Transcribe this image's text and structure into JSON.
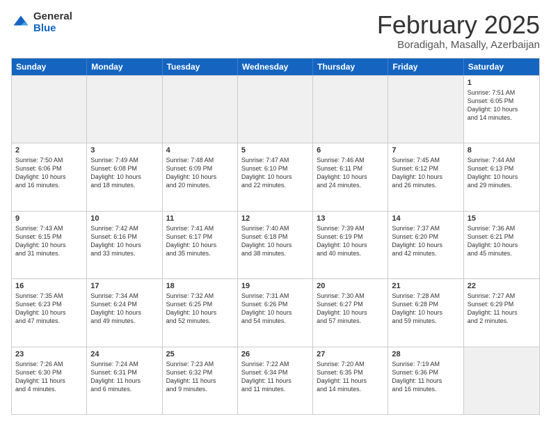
{
  "logo": {
    "general": "General",
    "blue": "Blue"
  },
  "title": "February 2025",
  "location": "Boradigah, Masally, Azerbaijan",
  "days": [
    "Sunday",
    "Monday",
    "Tuesday",
    "Wednesday",
    "Thursday",
    "Friday",
    "Saturday"
  ],
  "weeks": [
    [
      {
        "day": "",
        "info": ""
      },
      {
        "day": "",
        "info": ""
      },
      {
        "day": "",
        "info": ""
      },
      {
        "day": "",
        "info": ""
      },
      {
        "day": "",
        "info": ""
      },
      {
        "day": "",
        "info": ""
      },
      {
        "day": "1",
        "info": "Sunrise: 7:51 AM\nSunset: 6:05 PM\nDaylight: 10 hours\nand 14 minutes."
      }
    ],
    [
      {
        "day": "2",
        "info": "Sunrise: 7:50 AM\nSunset: 6:06 PM\nDaylight: 10 hours\nand 16 minutes."
      },
      {
        "day": "3",
        "info": "Sunrise: 7:49 AM\nSunset: 6:08 PM\nDaylight: 10 hours\nand 18 minutes."
      },
      {
        "day": "4",
        "info": "Sunrise: 7:48 AM\nSunset: 6:09 PM\nDaylight: 10 hours\nand 20 minutes."
      },
      {
        "day": "5",
        "info": "Sunrise: 7:47 AM\nSunset: 6:10 PM\nDaylight: 10 hours\nand 22 minutes."
      },
      {
        "day": "6",
        "info": "Sunrise: 7:46 AM\nSunset: 6:11 PM\nDaylight: 10 hours\nand 24 minutes."
      },
      {
        "day": "7",
        "info": "Sunrise: 7:45 AM\nSunset: 6:12 PM\nDaylight: 10 hours\nand 26 minutes."
      },
      {
        "day": "8",
        "info": "Sunrise: 7:44 AM\nSunset: 6:13 PM\nDaylight: 10 hours\nand 29 minutes."
      }
    ],
    [
      {
        "day": "9",
        "info": "Sunrise: 7:43 AM\nSunset: 6:15 PM\nDaylight: 10 hours\nand 31 minutes."
      },
      {
        "day": "10",
        "info": "Sunrise: 7:42 AM\nSunset: 6:16 PM\nDaylight: 10 hours\nand 33 minutes."
      },
      {
        "day": "11",
        "info": "Sunrise: 7:41 AM\nSunset: 6:17 PM\nDaylight: 10 hours\nand 35 minutes."
      },
      {
        "day": "12",
        "info": "Sunrise: 7:40 AM\nSunset: 6:18 PM\nDaylight: 10 hours\nand 38 minutes."
      },
      {
        "day": "13",
        "info": "Sunrise: 7:39 AM\nSunset: 6:19 PM\nDaylight: 10 hours\nand 40 minutes."
      },
      {
        "day": "14",
        "info": "Sunrise: 7:37 AM\nSunset: 6:20 PM\nDaylight: 10 hours\nand 42 minutes."
      },
      {
        "day": "15",
        "info": "Sunrise: 7:36 AM\nSunset: 6:21 PM\nDaylight: 10 hours\nand 45 minutes."
      }
    ],
    [
      {
        "day": "16",
        "info": "Sunrise: 7:35 AM\nSunset: 6:23 PM\nDaylight: 10 hours\nand 47 minutes."
      },
      {
        "day": "17",
        "info": "Sunrise: 7:34 AM\nSunset: 6:24 PM\nDaylight: 10 hours\nand 49 minutes."
      },
      {
        "day": "18",
        "info": "Sunrise: 7:32 AM\nSunset: 6:25 PM\nDaylight: 10 hours\nand 52 minutes."
      },
      {
        "day": "19",
        "info": "Sunrise: 7:31 AM\nSunset: 6:26 PM\nDaylight: 10 hours\nand 54 minutes."
      },
      {
        "day": "20",
        "info": "Sunrise: 7:30 AM\nSunset: 6:27 PM\nDaylight: 10 hours\nand 57 minutes."
      },
      {
        "day": "21",
        "info": "Sunrise: 7:28 AM\nSunset: 6:28 PM\nDaylight: 10 hours\nand 59 minutes."
      },
      {
        "day": "22",
        "info": "Sunrise: 7:27 AM\nSunset: 6:29 PM\nDaylight: 11 hours\nand 2 minutes."
      }
    ],
    [
      {
        "day": "23",
        "info": "Sunrise: 7:26 AM\nSunset: 6:30 PM\nDaylight: 11 hours\nand 4 minutes."
      },
      {
        "day": "24",
        "info": "Sunrise: 7:24 AM\nSunset: 6:31 PM\nDaylight: 11 hours\nand 6 minutes."
      },
      {
        "day": "25",
        "info": "Sunrise: 7:23 AM\nSunset: 6:32 PM\nDaylight: 11 hours\nand 9 minutes."
      },
      {
        "day": "26",
        "info": "Sunrise: 7:22 AM\nSunset: 6:34 PM\nDaylight: 11 hours\nand 11 minutes."
      },
      {
        "day": "27",
        "info": "Sunrise: 7:20 AM\nSunset: 6:35 PM\nDaylight: 11 hours\nand 14 minutes."
      },
      {
        "day": "28",
        "info": "Sunrise: 7:19 AM\nSunset: 6:36 PM\nDaylight: 11 hours\nand 16 minutes."
      },
      {
        "day": "",
        "info": ""
      }
    ]
  ]
}
